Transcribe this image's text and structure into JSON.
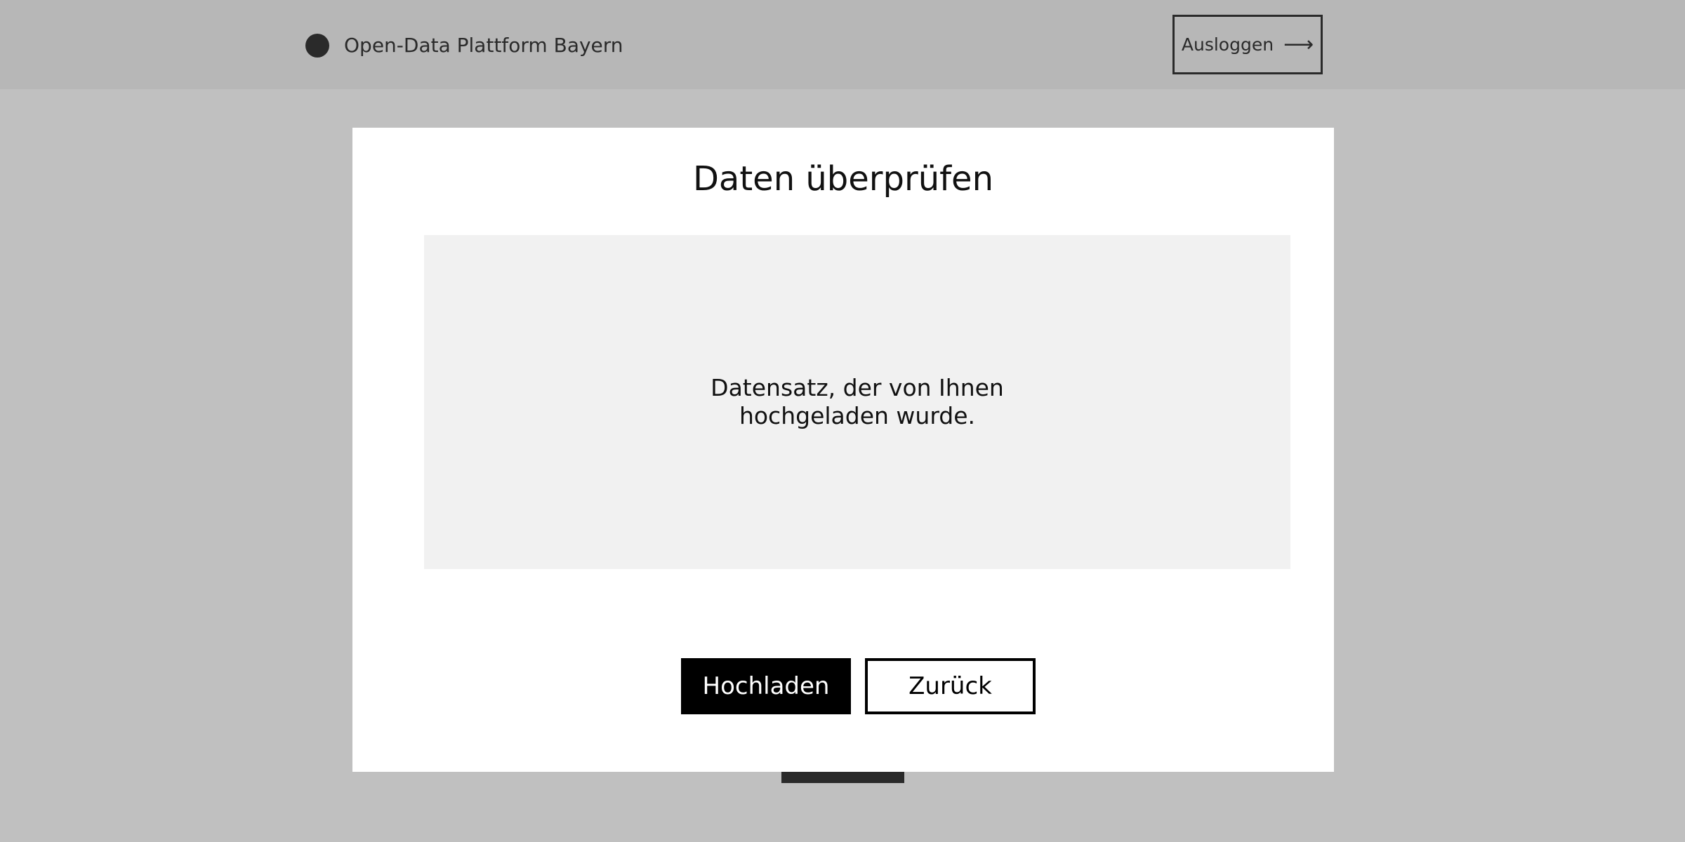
{
  "header": {
    "brand": "Open-Data Plattform Bayern",
    "logout_label": "Ausloggen",
    "logout_icon": "arrow-right-icon"
  },
  "modal": {
    "title": "Daten überprüfen",
    "preview_text": "Datensatz, der von Ihnen\nhochgeladen wurde.",
    "upload_label": "Hochladen",
    "back_label": "Zurück"
  },
  "colors": {
    "backdrop": "#c0c0c0",
    "header": "#b7b7b7",
    "primary_button": "#000000",
    "preview_background": "#f1f1f1"
  }
}
